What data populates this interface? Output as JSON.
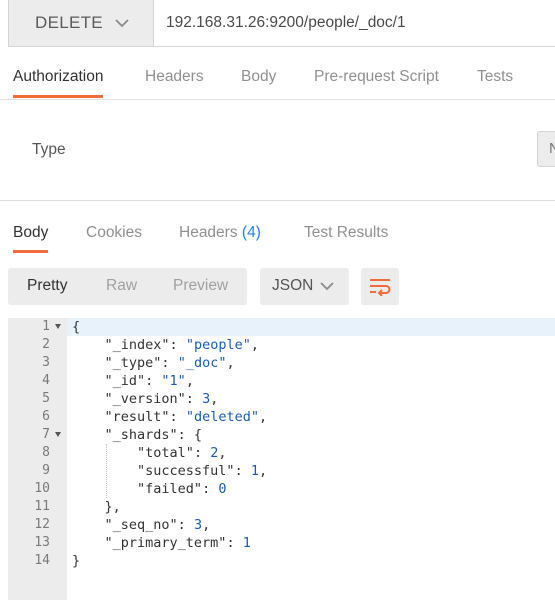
{
  "request": {
    "method": "DELETE",
    "url": "192.168.31.26:9200/people/_doc/1"
  },
  "request_tabs": [
    {
      "label": "Authorization",
      "active": true
    },
    {
      "label": "Headers",
      "active": false
    },
    {
      "label": "Body",
      "active": false
    },
    {
      "label": "Pre-request Script",
      "active": false
    },
    {
      "label": "Tests",
      "active": false
    }
  ],
  "auth": {
    "type_label": "Type",
    "type_value": "N"
  },
  "response_tabs": [
    {
      "label": "Body",
      "active": true
    },
    {
      "label": "Cookies",
      "active": false
    },
    {
      "label": "Headers",
      "count": "(4)",
      "active": false
    },
    {
      "label": "Test Results",
      "active": false
    }
  ],
  "view_modes": [
    "Pretty",
    "Raw",
    "Preview"
  ],
  "active_view_mode": "Pretty",
  "format": "JSON",
  "icons": {
    "method_dropdown": "chevron-down-icon",
    "format_dropdown": "chevron-down-icon",
    "wrap": "wrap-lines-icon",
    "fold": "fold-arrow-icon"
  },
  "colors": {
    "accent": "#f26b3a",
    "link": "#2680eb",
    "code_value": "#1a5bb5"
  },
  "code_lines": [
    {
      "n": "1",
      "fold": true,
      "text": "{"
    },
    {
      "n": "2",
      "text": "    \"_index\": \"people\","
    },
    {
      "n": "3",
      "text": "    \"_type\": \"_doc\","
    },
    {
      "n": "4",
      "text": "    \"_id\": \"1\","
    },
    {
      "n": "5",
      "text": "    \"_version\": 3,"
    },
    {
      "n": "6",
      "text": "    \"result\": \"deleted\","
    },
    {
      "n": "7",
      "fold": true,
      "text": "    \"_shards\": {"
    },
    {
      "n": "8",
      "text": "        \"total\": 2,"
    },
    {
      "n": "9",
      "text": "        \"successful\": 1,"
    },
    {
      "n": "10",
      "text": "        \"failed\": 0"
    },
    {
      "n": "11",
      "text": "    },"
    },
    {
      "n": "12",
      "text": "    \"_seq_no\": 3,"
    },
    {
      "n": "13",
      "text": "    \"_primary_term\": 1"
    },
    {
      "n": "14",
      "text": "}"
    }
  ]
}
